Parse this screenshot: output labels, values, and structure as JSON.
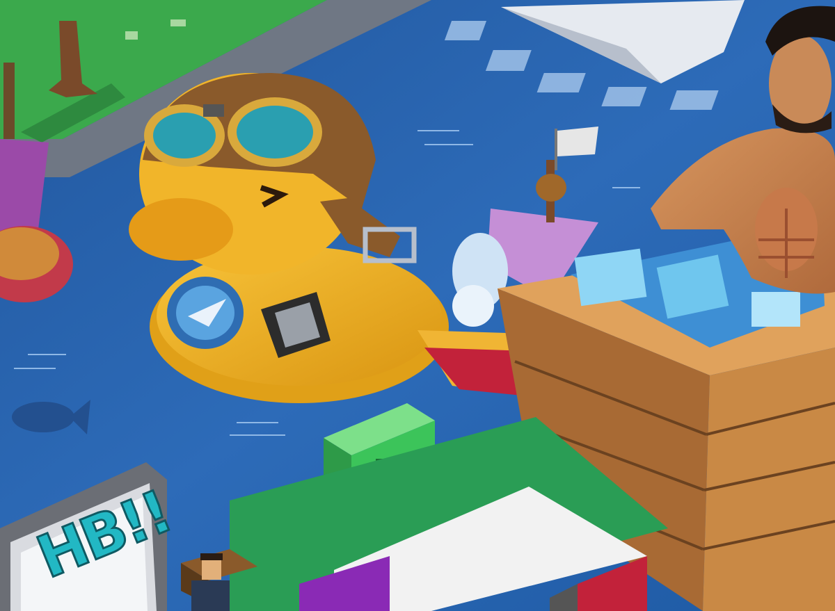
{
  "scene": {
    "sign_text": "HB!!"
  },
  "colors": {
    "water": "#2d6bb8",
    "water_dark": "#1f4f94",
    "duck_yellow": "#f2b62a",
    "duck_shadow": "#c98a12",
    "helmet_brown": "#8a5a2b",
    "goggle_teal": "#2a9fb0",
    "crate_wood": "#c98945",
    "ice_blue": "#6fc6ee",
    "grass_green": "#3cc45a",
    "sign_teal": "#22b8c4"
  },
  "icons": [
    "paper-plane-icon",
    "flag-icon",
    "fish-icon",
    "badge-plane-icon"
  ]
}
